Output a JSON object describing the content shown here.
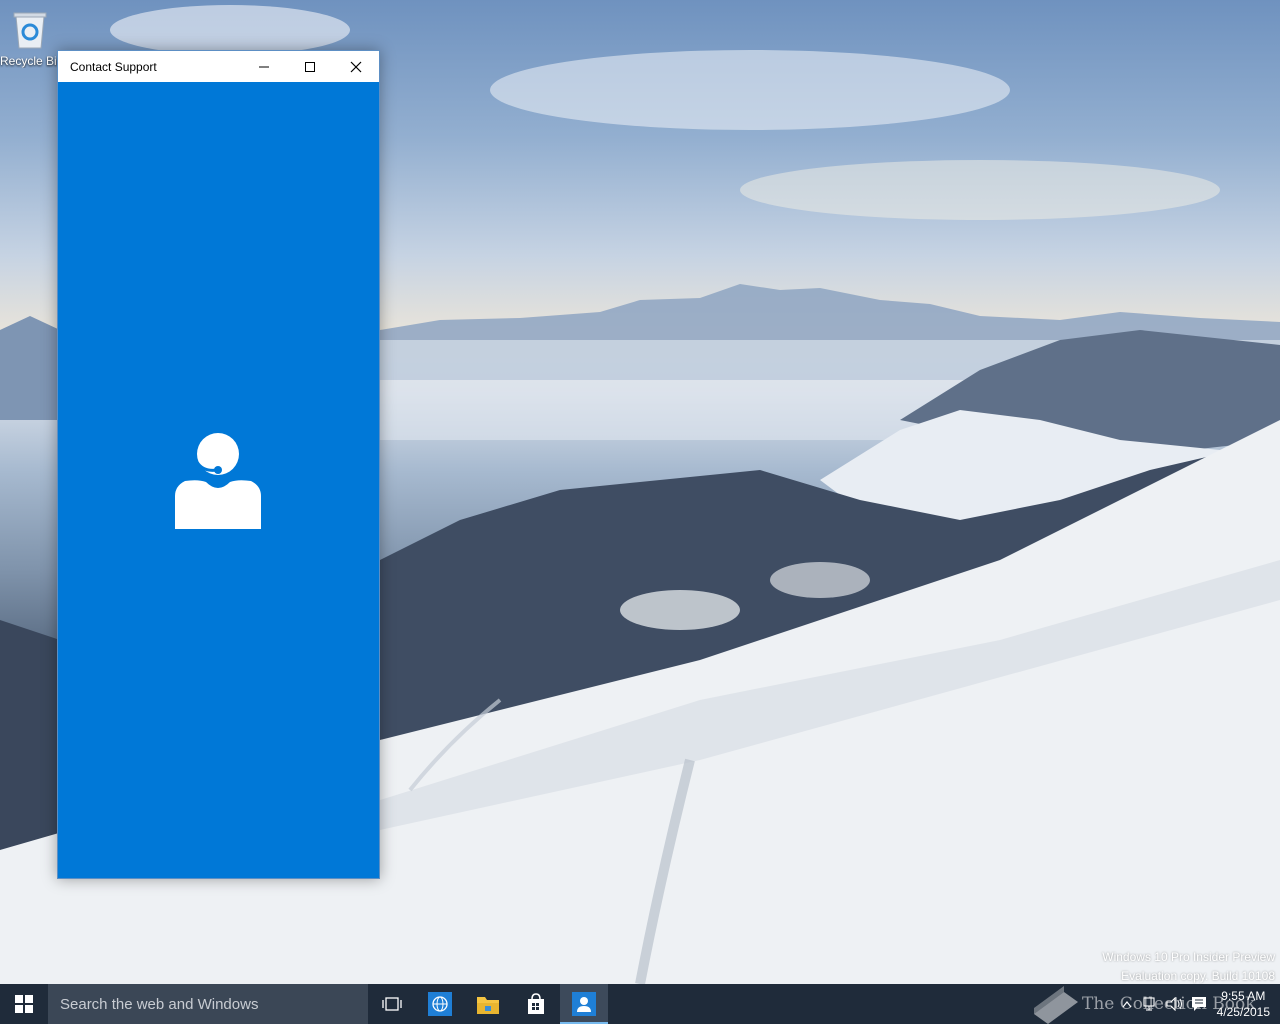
{
  "desktop": {
    "recycle_bin_label": "Recycle Bin"
  },
  "window": {
    "title": "Contact Support",
    "minimize_glyph": "—",
    "maximize_glyph": "☐",
    "close_glyph": "✕",
    "accent_color": "#0078d7",
    "center_icon": "support-agent-icon"
  },
  "watermark": {
    "line1": "Windows 10 Pro Insider Preview",
    "line2": "Evaluation copy. Build 10108"
  },
  "taskbar": {
    "search_placeholder": "Search the web and Windows",
    "apps": [
      {
        "name": "task-view",
        "icon": "task-view-icon"
      },
      {
        "name": "browser",
        "icon": "globe-icon"
      },
      {
        "name": "file-explorer",
        "icon": "folder-icon"
      },
      {
        "name": "store",
        "icon": "store-bag-icon"
      },
      {
        "name": "contact-support",
        "icon": "person-icon",
        "active": true
      }
    ],
    "brand_text": "The Collection Book",
    "clock": {
      "time": "9:55 AM",
      "date": "4/25/2015"
    }
  }
}
